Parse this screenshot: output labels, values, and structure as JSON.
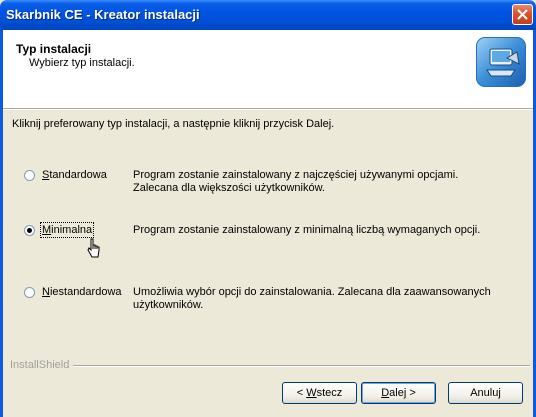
{
  "window": {
    "title": "Skarbnik CE - Kreator instalacji"
  },
  "header": {
    "title": "Typ instalacji",
    "subtitle": "Wybierz typ instalacji."
  },
  "instruction": "Kliknij preferowany typ instalacji, a następnie kliknij przycisk Dalej.",
  "options": [
    {
      "label": "Standardowa",
      "accel": "S",
      "rest": "tandardowa",
      "checked": false,
      "description": "Program zostanie zainstalowany z najczęściej używanymi opcjami. Zalecana dla większości użytkowników."
    },
    {
      "label": "Minimalna",
      "accel": "M",
      "rest": "inimalna",
      "checked": true,
      "description": "Program zostanie zainstalowany z minimalną liczbą wymaganych opcji."
    },
    {
      "label": "Niestandardowa",
      "accel": "N",
      "rest": "iestandardowa",
      "checked": false,
      "description": "Umożliwia wybór opcji do zainstalowania. Zalecana dla zaawansowanych użytkowników."
    }
  ],
  "branding": "InstallShield",
  "buttons": {
    "back": {
      "pre": "< ",
      "accel": "W",
      "rest": "stecz"
    },
    "next": {
      "accel": "D",
      "rest": "alej >"
    },
    "cancel": "Anuluj"
  },
  "colors": {
    "titlebar": "#0054E3",
    "dialog_bg": "#ECE9D8",
    "close": "#D9532B"
  }
}
